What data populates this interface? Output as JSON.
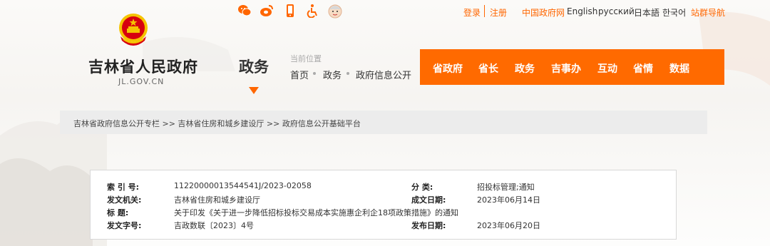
{
  "top": {
    "login": "登录",
    "register": "注册",
    "links": [
      "中国政府网",
      "English",
      "русский",
      "日本語",
      "한국어",
      "站群导航"
    ]
  },
  "logo": {
    "name": "吉林省人民政府",
    "domain": "JL.GOV.CN"
  },
  "section": {
    "title": "政务"
  },
  "location": {
    "label": "当前位置",
    "crumbs": [
      "首页",
      "政务",
      "政府信息公开"
    ]
  },
  "nav": {
    "items": [
      "省政府",
      "省长",
      "政务",
      "吉事办",
      "互动",
      "省情",
      "数据"
    ]
  },
  "breadcrumb": {
    "text": "吉林省政府信息公开专栏 >> 吉林省住房和城乡建设厅 >> 政府信息公开基础平台"
  },
  "info": {
    "index_label": "索 引 号:",
    "index_value": "11220000013544541J/2023-02058",
    "category_label": "分 类:",
    "category_value": "招投标管理;通知",
    "issuer_label": "发文机关:",
    "issuer_value": "吉林省住房和城乡建设厅",
    "written_date_label": "成文日期:",
    "written_date_value": "2023年06月14日",
    "title_label": "标 题:",
    "title_value": "关于印发《关于进一步降低招标投标交易成本实施惠企利企18项政策措施》的通知",
    "doc_no_label": "发文字号:",
    "doc_no_value": "吉政数联〔2023〕4号",
    "publish_date_label": "发布日期:",
    "publish_date_value": "2023年06月20日"
  },
  "colors": {
    "accent": "#ff6a00",
    "emblem_red": "#d7000f",
    "emblem_gold": "#f5c400"
  },
  "icons": [
    "wechat-icon",
    "weibo-icon",
    "mobile-icon",
    "accessibility-icon",
    "elderly-mode-icon"
  ]
}
